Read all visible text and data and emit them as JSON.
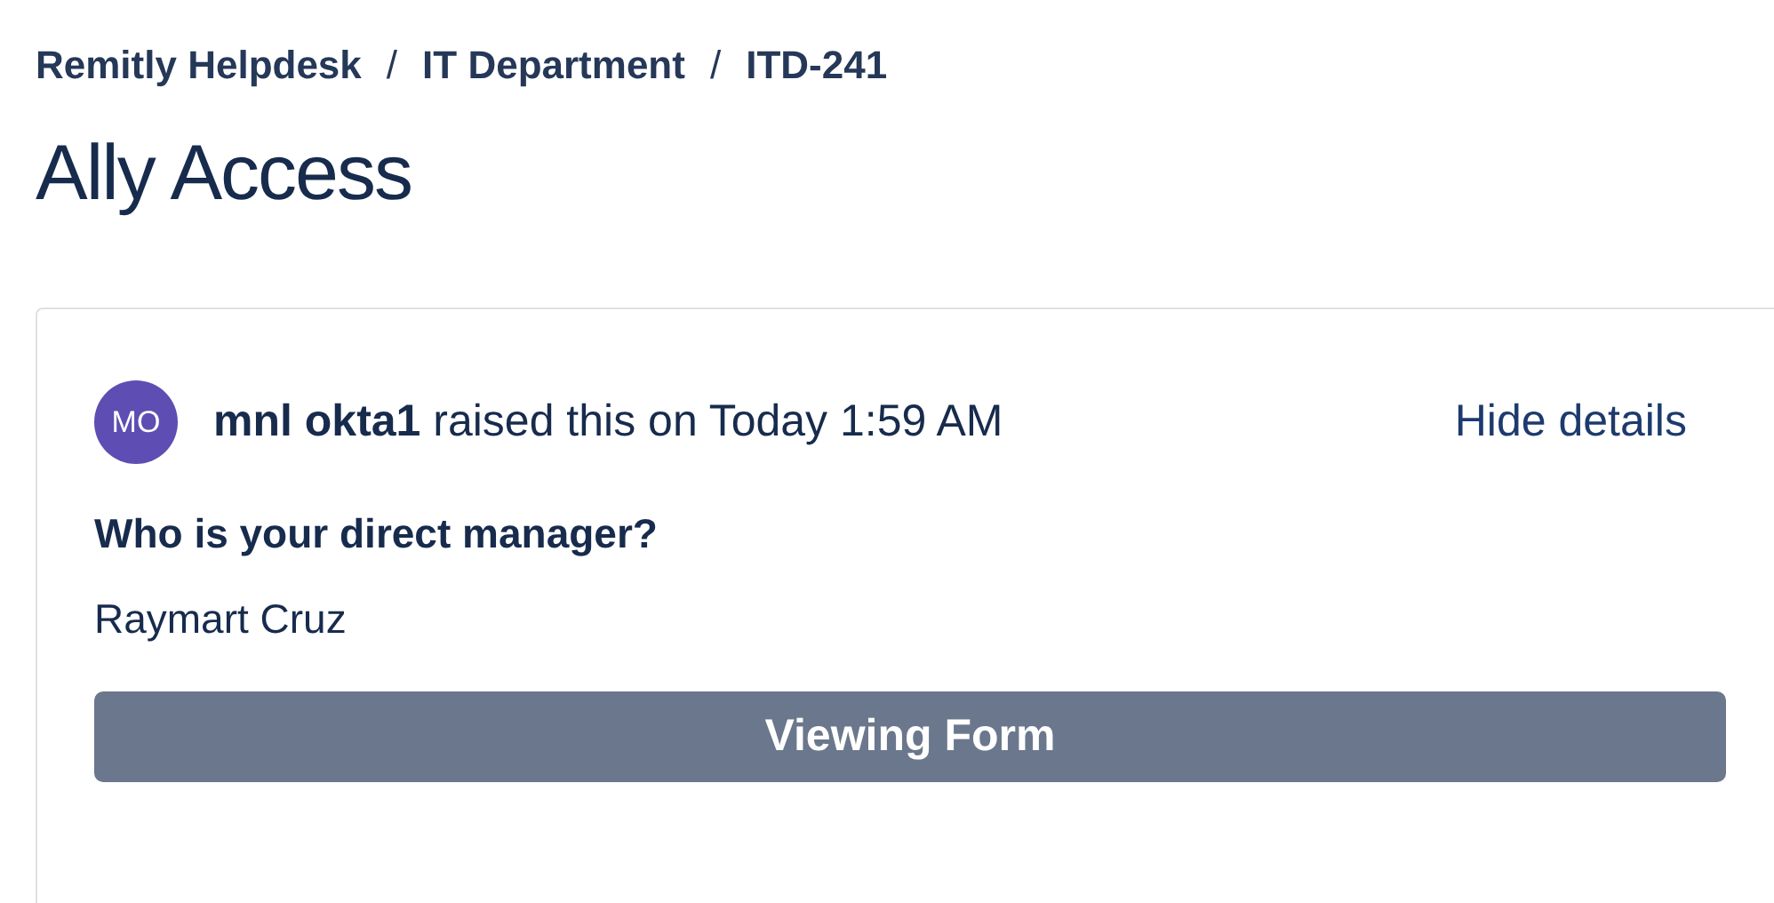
{
  "breadcrumbs": [
    {
      "label": "Remitly Helpdesk"
    },
    {
      "label": "IT Department"
    },
    {
      "label": "ITD-241"
    }
  ],
  "breadcrumb_separator": "/",
  "title": "Ally Access",
  "request": {
    "avatar_initials": "MO",
    "raised_text": "**mnl okta1** raised this on Today 1:59 AM",
    "hide_details": "Hide details",
    "fields": [
      {
        "question": "Who is your direct manager?",
        "answer": "Raymart Cruz"
      }
    ],
    "button": "Viewing Form"
  }
}
